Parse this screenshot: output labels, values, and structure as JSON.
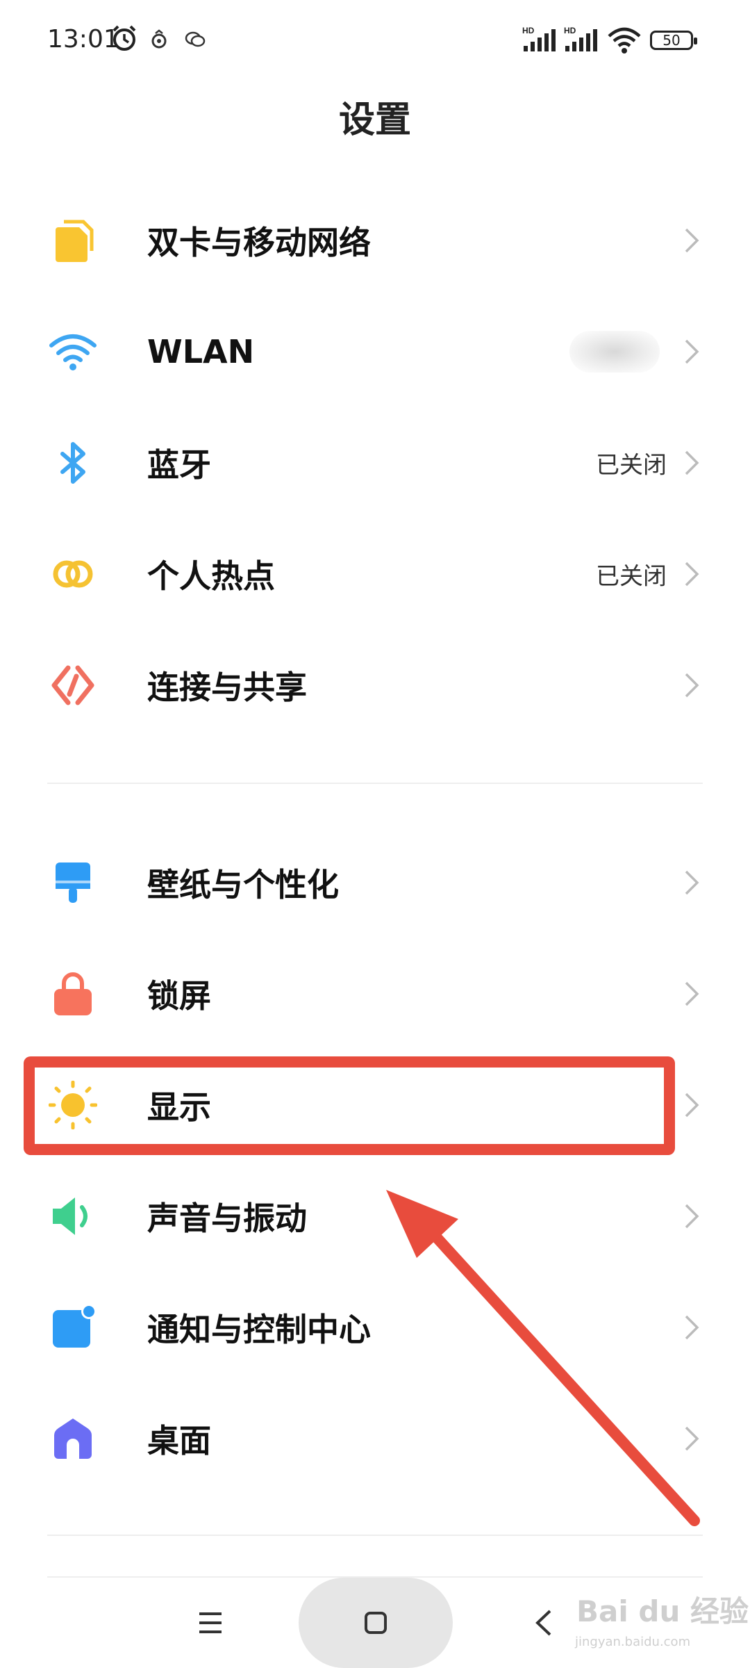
{
  "status_bar": {
    "time": "13:01",
    "battery": "50",
    "icons": [
      "alarm-icon",
      "notification-icon",
      "wechat-icon",
      "hd-signal-icon",
      "hd-signal-icon",
      "wifi-icon",
      "battery-icon"
    ]
  },
  "page": {
    "title": "设置"
  },
  "sections": [
    {
      "items": [
        {
          "label": "双卡与移动网络",
          "icon": "sim-card-icon",
          "value": ""
        },
        {
          "label": "WLAN",
          "icon": "wifi-icon",
          "value": ""
        },
        {
          "label": "蓝牙",
          "icon": "bluetooth-icon",
          "value": "已关闭"
        },
        {
          "label": "个人热点",
          "icon": "hotspot-icon",
          "value": "已关闭"
        },
        {
          "label": "连接与共享",
          "icon": "connection-share-icon",
          "value": ""
        }
      ]
    },
    {
      "items": [
        {
          "label": "壁纸与个性化",
          "icon": "wallpaper-brush-icon",
          "value": ""
        },
        {
          "label": "锁屏",
          "icon": "lock-icon",
          "value": ""
        },
        {
          "label": "显示",
          "icon": "sun-icon",
          "value": ""
        },
        {
          "label": "声音与振动",
          "icon": "speaker-icon",
          "value": ""
        },
        {
          "label": "通知与控制中心",
          "icon": "notification-center-icon",
          "value": ""
        },
        {
          "label": "桌面",
          "icon": "home-icon",
          "value": ""
        }
      ]
    }
  ],
  "annotation": {
    "highlight_color": "#e84c3d",
    "highlighted_item": "显示"
  },
  "colors": {
    "sim_yellow": "#f9c531",
    "wifi_blue": "#3ea6f2",
    "hotspot_yellow": "#f5c232",
    "connection_red": "#f07060",
    "wallpaper_blue": "#2e9cf5",
    "lock_coral": "#f7735d",
    "sun_yellow": "#f8c22e",
    "sound_green": "#3fcf8e",
    "notify_blue": "#2e9cf5",
    "home_purple": "#6b6df4"
  },
  "watermark": {
    "text": "Bai du 经验",
    "sub": "jingyan.baidu.com"
  }
}
